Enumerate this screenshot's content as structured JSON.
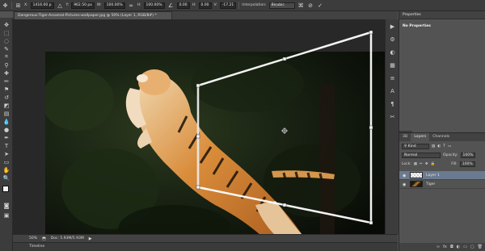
{
  "options_bar": {
    "x_label": "X:",
    "x_value": "1416.00 p",
    "y_label": "Y:",
    "y_value": "962.50 px",
    "w_label": "W:",
    "w_value": "100.00%",
    "h_label": "H:",
    "h_value": "100.00%",
    "angle_value": "0.00",
    "hskew_label": "H:",
    "hskew_value": "0.00",
    "vskew_label": "V:",
    "vskew_value": "-17.21",
    "interpolation_label": "Interpolation:",
    "interpolation_value": "Bicubic"
  },
  "document": {
    "tab_title": "Dangerous-Tiger-Assamal-Pictures-wallpaper.jpg @ 50% (Layer 1, RGB/8#) *"
  },
  "status_bar": {
    "zoom": "50%",
    "doc_info": "Doc: 5.93M/5.93M"
  },
  "timeline": {
    "label": "Timeline"
  },
  "properties": {
    "title": "Properties",
    "body": "No Properties"
  },
  "layers": {
    "tabs": [
      "3D",
      "Layers",
      "Channels"
    ],
    "kind_label": "Kind",
    "blend_mode": "Normal",
    "opacity_label": "Opacity:",
    "opacity_value": "100%",
    "lock_label": "Lock:",
    "fill_label": "Fill:",
    "fill_value": "100%",
    "items": [
      {
        "name": "Layer 1",
        "selected": true
      },
      {
        "name": "Tiger",
        "selected": false
      }
    ]
  },
  "colors": {
    "accent_selection": "#6b7a8f",
    "panel": "#535353",
    "chrome": "#3c3c3c",
    "canvas_bg": "#282828"
  }
}
